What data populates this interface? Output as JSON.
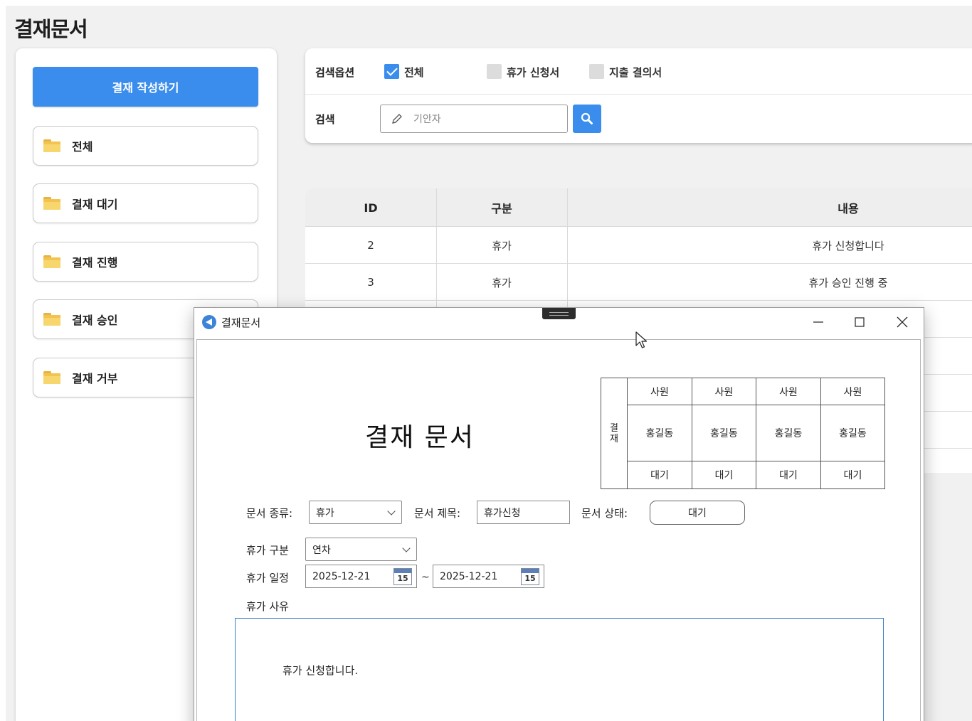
{
  "page": {
    "title": "결재문서"
  },
  "sidebar": {
    "compose_label": "결재 작성하기",
    "folders": [
      "전체",
      "결재 대기",
      "결재 진행",
      "결재 승인",
      "결재 거부"
    ]
  },
  "search": {
    "options_label": "검색옵션",
    "checkboxes": [
      {
        "label": "전체",
        "checked": true
      },
      {
        "label": "휴가 신청서",
        "checked": false
      },
      {
        "label": "지출 결의서",
        "checked": false
      }
    ],
    "search_label": "검색",
    "placeholder": "기안자"
  },
  "table": {
    "columns": [
      "ID",
      "구분",
      "내용"
    ],
    "rows": [
      {
        "id": "2",
        "type": "휴가",
        "content": "휴가 신청합니다"
      },
      {
        "id": "3",
        "type": "휴가",
        "content": "휴가 승인 진행 중"
      }
    ]
  },
  "dialog": {
    "title": "결재문서",
    "heading": "결재 문서",
    "approval": {
      "side_label": [
        "결",
        "재"
      ],
      "columns": [
        {
          "role": "사원",
          "name": "홍길동",
          "status": "대기"
        },
        {
          "role": "사원",
          "name": "홍길동",
          "status": "대기"
        },
        {
          "role": "사원",
          "name": "홍길동",
          "status": "대기"
        },
        {
          "role": "사원",
          "name": "홍길동",
          "status": "대기"
        }
      ]
    },
    "form": {
      "doc_type_label": "문서 종류:",
      "doc_type_value": "휴가",
      "doc_title_label": "문서 제목:",
      "doc_title_value": "휴가신청",
      "doc_status_label": "문서 상태:",
      "doc_status_value": "대기",
      "leave_type_label": "휴가 구분",
      "leave_type_value": "연차",
      "leave_period_label": "휴가 일정",
      "start_date": "2025-12-21",
      "range_sep": "~",
      "end_date": "2025-12-21",
      "calendar_day": "15",
      "reason_label": "휴가 사유",
      "reason_value": "휴가 신청합니다."
    }
  },
  "colors": {
    "accent": "#3a8ded",
    "app_bg": "#f1f1f1"
  }
}
